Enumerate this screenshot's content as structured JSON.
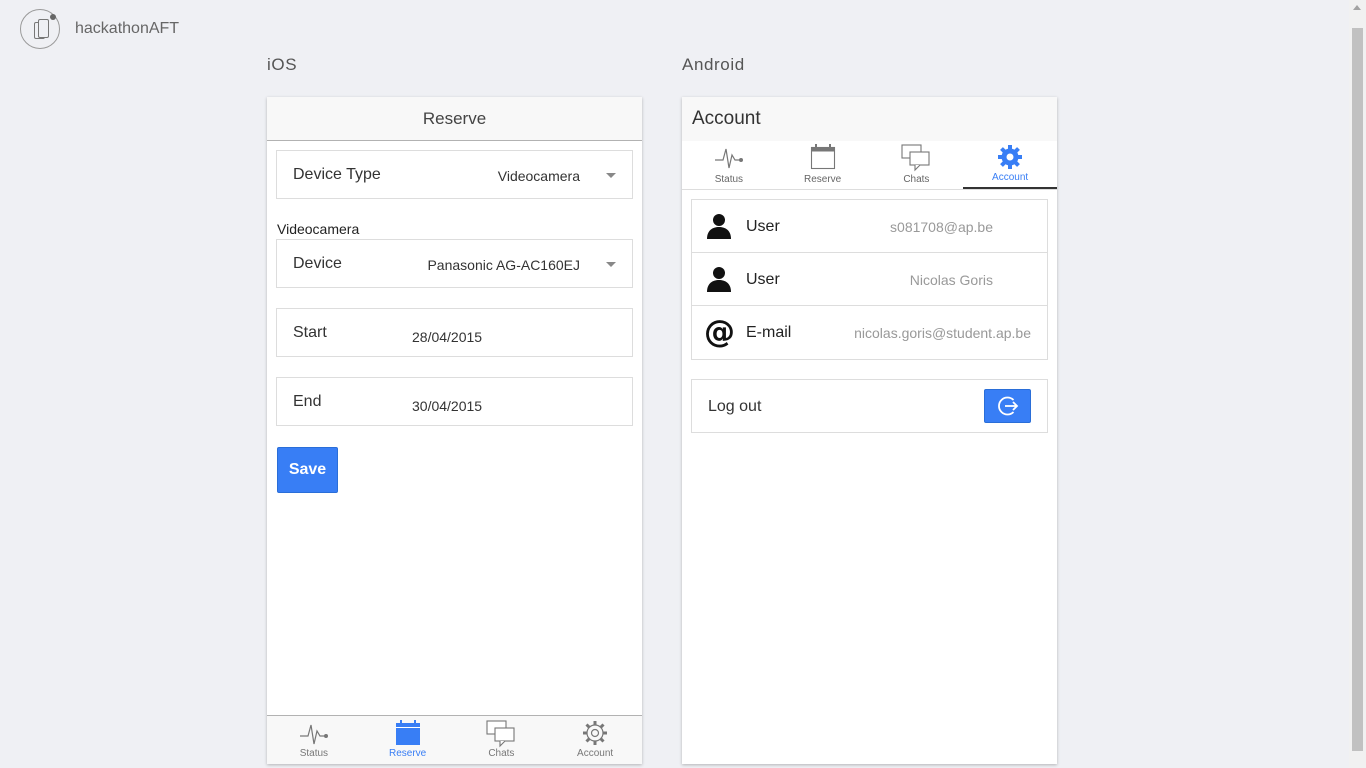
{
  "app": {
    "title": "hackathonAFT",
    "logo_icon": "devices-logo-icon"
  },
  "ios": {
    "heading": "iOS",
    "header_title": "Reserve",
    "device_type": {
      "label": "Device Type",
      "value": "Videocamera"
    },
    "device_section_label": "Videocamera",
    "device": {
      "label": "Device",
      "value": "Panasonic AG-AC160EJ"
    },
    "start": {
      "label": "Start",
      "value": "28/04/2015"
    },
    "end": {
      "label": "End",
      "value": "30/04/2015"
    },
    "save_label": "Save",
    "tabs": [
      {
        "label": "Status",
        "icon": "pulse-icon",
        "active": false
      },
      {
        "label": "Reserve",
        "icon": "calendar-icon",
        "active": true
      },
      {
        "label": "Chats",
        "icon": "chats-icon",
        "active": false
      },
      {
        "label": "Account",
        "icon": "gear-icon",
        "active": false
      }
    ]
  },
  "android": {
    "heading": "Android",
    "header_title": "Account",
    "tabs": [
      {
        "label": "Status",
        "icon": "pulse-icon",
        "active": false
      },
      {
        "label": "Reserve",
        "icon": "calendar-icon",
        "active": false
      },
      {
        "label": "Chats",
        "icon": "chats-icon",
        "active": false
      },
      {
        "label": "Account",
        "icon": "gear-icon",
        "active": true
      }
    ],
    "account_rows": [
      {
        "label": "User",
        "value": "s081708@ap.be",
        "icon": "person-icon"
      },
      {
        "label": "User",
        "value": "Nicolas Goris",
        "icon": "person-icon"
      },
      {
        "label": "E-mail",
        "value": "nicolas.goris@student.ap.be",
        "icon": "at-icon"
      }
    ],
    "logout_label": "Log out",
    "logout_icon": "logout-icon"
  },
  "colors": {
    "accent": "#387ef5",
    "background": "#eff0f4",
    "inactive": "#777777"
  }
}
